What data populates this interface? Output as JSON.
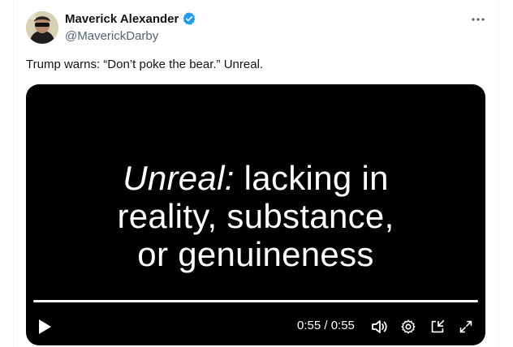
{
  "author": {
    "display_name": "Maverick Alexander",
    "handle": "@MaverickDarby",
    "verified": true,
    "verified_color": "#1d9bf0"
  },
  "tweet": {
    "text": "Trump warns: “Don’t poke the bear.” Unreal."
  },
  "video": {
    "caption_italic": "Unreal:",
    "caption_line1_rest": " lacking in",
    "caption_line2": "reality, substance,",
    "caption_line3": "or genuineness",
    "time_display": "0:55 / 0:55",
    "progress_fraction": 1.0
  },
  "icons": {
    "more": "more-horizontal-icon",
    "play": "play-icon",
    "volume": "volume-icon",
    "settings": "settings-gear-icon",
    "dock": "dock-minimize-icon",
    "fullscreen": "fullscreen-icon"
  }
}
